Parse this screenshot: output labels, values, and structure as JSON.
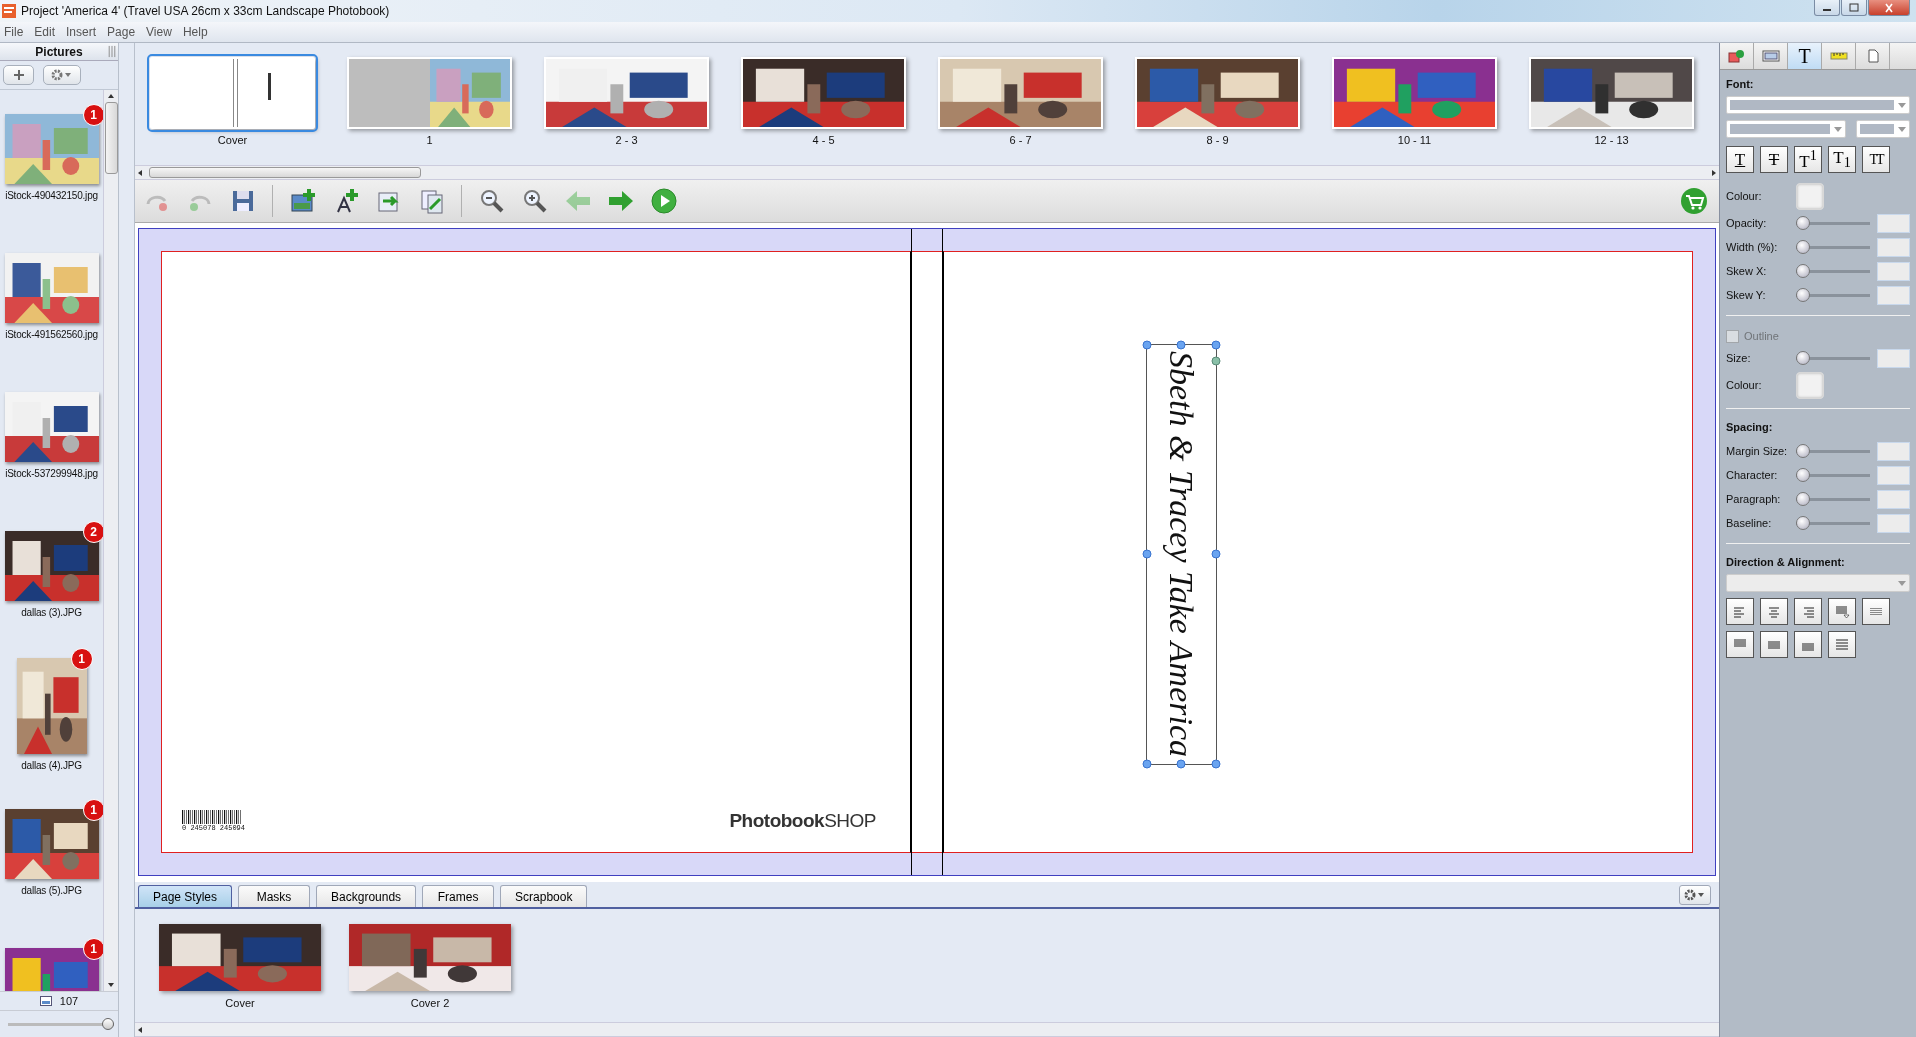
{
  "window": {
    "title": "Project 'America 4' (Travel USA 26cm x 33cm Landscape Photobook)"
  },
  "menu": [
    "File",
    "Edit",
    "Insert",
    "Page",
    "View",
    "Help"
  ],
  "sidebar": {
    "title": "Pictures",
    "items": [
      {
        "name": "iStock-490432150.jpg",
        "badge": "1",
        "kind": "wide"
      },
      {
        "name": "iStock-491562560.jpg",
        "kind": "wide"
      },
      {
        "name": "iStock-537299948.jpg",
        "kind": "wide"
      },
      {
        "name": "dallas (3).JPG",
        "badge": "2",
        "kind": "wide"
      },
      {
        "name": "dallas (4).JPG",
        "badge": "1",
        "kind": "tall"
      },
      {
        "name": "dallas (5).JPG",
        "badge": "1",
        "kind": "wide"
      },
      {
        "badge": "1",
        "kind": "wide"
      }
    ],
    "count": "107",
    "zoom": {
      "level": 1
    }
  },
  "pages": [
    {
      "label": "Cover",
      "kind": "blank",
      "selected": true
    },
    {
      "label": "1",
      "kind": "half",
      "selected": false
    },
    {
      "label": "2 - 3",
      "kind": "picture",
      "selected": false
    },
    {
      "label": "4 - 5",
      "kind": "picture",
      "selected": false
    },
    {
      "label": "6 - 7",
      "kind": "picture",
      "selected": false
    },
    {
      "label": "8 - 9",
      "kind": "picture",
      "selected": false
    },
    {
      "label": "10 - 11",
      "kind": "picture",
      "selected": false
    },
    {
      "label": "12 - 13",
      "kind": "picture",
      "selected": false
    }
  ],
  "toolbar": [
    {
      "kind": "undo",
      "disabled": true
    },
    {
      "kind": "redo",
      "disabled": true
    },
    {
      "kind": "save",
      "disabled": false
    },
    {
      "kind": "add-picture",
      "disabled": false
    },
    {
      "kind": "add-text",
      "disabled": false
    },
    {
      "kind": "import",
      "disabled": false
    },
    {
      "kind": "export",
      "disabled": false
    },
    {
      "kind": "zoom-out",
      "disabled": false
    },
    {
      "kind": "zoom-in",
      "disabled": false
    },
    {
      "kind": "back",
      "disabled": true
    },
    {
      "kind": "forward",
      "disabled": false
    },
    {
      "kind": "play",
      "disabled": false
    },
    {
      "kind": "cart",
      "disabled": false
    }
  ],
  "spread": {
    "barcode_digits": "0 245078 245094",
    "logo": "**Photobook**SHOP",
    "title_text": "Sbeth & Tracey Take America",
    "title_selected": true
  },
  "bottom_tabs": [
    {
      "label": "Page Styles",
      "selected": true
    },
    {
      "label": "Masks",
      "selected": false
    },
    {
      "label": "Backgrounds",
      "selected": false
    },
    {
      "label": "Frames",
      "selected": false
    },
    {
      "label": "Scrapbook",
      "selected": false
    }
  ],
  "page_styles": [
    {
      "label": "Cover",
      "kind": "picture"
    },
    {
      "label": "Cover 2",
      "kind": "picture"
    }
  ],
  "panel": {
    "tabs": [
      {
        "kind": "shape",
        "selected": false
      },
      {
        "kind": "frame",
        "selected": false
      },
      {
        "kind": "text",
        "label": "T",
        "selected": true
      },
      {
        "kind": "ruler",
        "selected": false
      },
      {
        "kind": "page",
        "selected": false
      }
    ],
    "font_heading": "Font:",
    "style_buttons": [
      {
        "label": "T",
        "kind": "underline"
      },
      {
        "label": "T",
        "kind": "strike"
      },
      {
        "label": "T$^{1}$",
        "kind": "plain"
      },
      {
        "label": "T$_{1}$",
        "kind": "plain"
      },
      {
        "label": "TT",
        "kind": "small"
      }
    ],
    "colour_label": "Colour:",
    "sliders": [
      {
        "label": "Opacity:",
        "level": 0
      },
      {
        "label": "Width (%):",
        "level": 0
      },
      {
        "label": "Skew X:",
        "level": 0
      },
      {
        "label": "Skew Y:",
        "level": 0
      }
    ],
    "outline": {
      "label": "Outline",
      "checked": false,
      "disabled": true
    },
    "outline_sliders": [
      {
        "label": "Size:",
        "level": 0
      }
    ],
    "outline_colour_label": "Colour:",
    "spacing_heading": "Spacing:",
    "spacing_sliders": [
      {
        "label": "Margin Size:",
        "level": 0
      },
      {
        "label": "Character:",
        "level": 0
      },
      {
        "label": "Paragraph:",
        "level": 0
      },
      {
        "label": "Baseline:",
        "level": 0
      }
    ],
    "direction_heading": "Direction & Alignment:",
    "align_buttons": [
      {
        "kind": "left"
      },
      {
        "kind": "center"
      },
      {
        "kind": "right"
      },
      {
        "kind": "menu"
      },
      {
        "kind": "grid"
      },
      {
        "kind": "justify-top"
      },
      {
        "kind": "justify"
      },
      {
        "kind": "justify-bottom"
      },
      {
        "kind": "spread"
      }
    ]
  }
}
